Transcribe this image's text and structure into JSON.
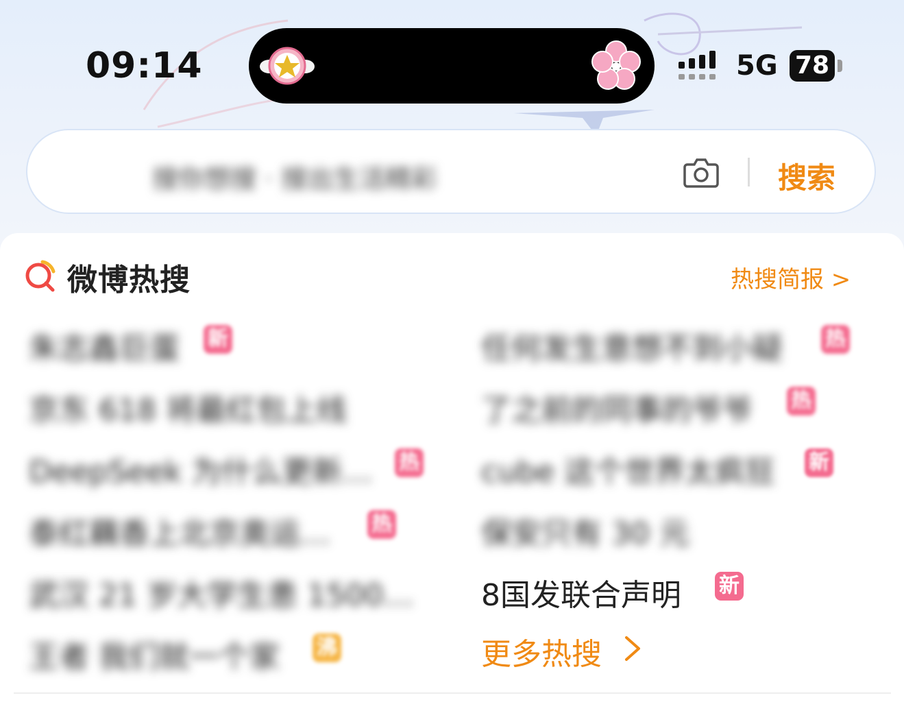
{
  "status_bar": {
    "time": "09:14",
    "network": "5G",
    "battery": "78"
  },
  "search": {
    "placeholder": "搜你想搜 · 搜出生活精彩",
    "button_label": "搜索"
  },
  "hot_search": {
    "title": "微博热搜",
    "brief_link": "热搜简报 >",
    "left_items": [
      {
        "text": "朱志鑫巨蛋",
        "badge": "新",
        "badge_color": "#f46b8f"
      },
      {
        "text": "京东 618 将最红包上线",
        "badge": "",
        "badge_color": ""
      },
      {
        "text": "DeepSeek 为什么更新…",
        "badge": "热",
        "badge_color": "#f46b8f"
      },
      {
        "text": "泰红藕香上北京奥运…",
        "badge": "热",
        "badge_color": "#f46b8f"
      },
      {
        "text": "武汉 21 岁大学生患 1500…",
        "badge": "",
        "badge_color": ""
      },
      {
        "text": "王者 我们就一个家",
        "badge": "沸",
        "badge_color": "#f6b74a"
      }
    ],
    "right_items": [
      {
        "text": "任何发生意想不到小疑",
        "badge": "热",
        "badge_color": "#f46b8f"
      },
      {
        "text": "了之前的同事的爷爷",
        "badge": "热",
        "badge_color": "#f46b8f"
      },
      {
        "text": "cube 这个世界太疯狂",
        "badge": "新",
        "badge_color": "#f46b8f"
      },
      {
        "text": "保安只有 30 元",
        "badge": "",
        "badge_color": ""
      },
      {
        "text": "8国发联合声明",
        "badge": "新",
        "badge_color": "#f46b8f"
      }
    ],
    "more_label": "更多热搜"
  },
  "colors": {
    "accent": "#f08a14",
    "badge_pink": "#f46b8f",
    "badge_gold": "#f6b74a"
  },
  "icons": [
    "star-wing-icon",
    "sakura-icon",
    "signal-icon",
    "camera-icon",
    "hot-search-logo-icon",
    "chevron-right-icon"
  ]
}
